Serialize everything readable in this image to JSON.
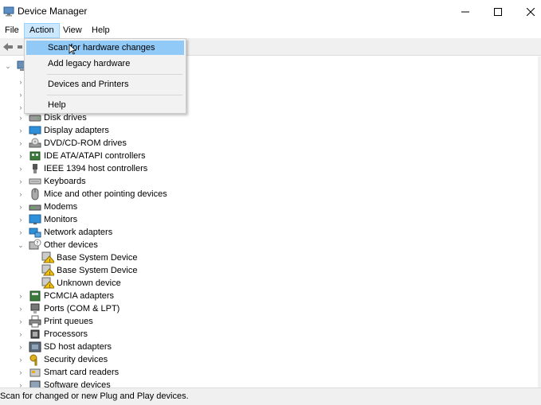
{
  "window": {
    "title": "Device Manager",
    "icons": {
      "app": "device-manager-icon",
      "minimize": "minimize-icon",
      "maximize": "maximize-icon",
      "close": "close-icon"
    }
  },
  "menubar": {
    "file": "File",
    "action": "Action",
    "view": "View",
    "help": "Help"
  },
  "action_menu": {
    "items": [
      {
        "label": "Scan for hardware changes",
        "highlighted": true
      },
      {
        "label": "Add legacy hardware"
      },
      {
        "label": "Devices and Printers"
      },
      {
        "label": "Help"
      }
    ]
  },
  "tree": {
    "items": [
      {
        "label": "Disk drives",
        "icon": "disk-drive-icon",
        "expanded": false
      },
      {
        "label": "Display adapters",
        "icon": "display-adapter-icon",
        "expanded": false
      },
      {
        "label": "DVD/CD-ROM drives",
        "icon": "dvd-drive-icon",
        "expanded": false
      },
      {
        "label": "IDE ATA/ATAPI controllers",
        "icon": "ide-controller-icon",
        "expanded": false
      },
      {
        "label": "IEEE 1394 host controllers",
        "icon": "firewire-icon",
        "expanded": false
      },
      {
        "label": "Keyboards",
        "icon": "keyboard-icon",
        "expanded": false
      },
      {
        "label": "Mice and other pointing devices",
        "icon": "mouse-icon",
        "expanded": false
      },
      {
        "label": "Modems",
        "icon": "modem-icon",
        "expanded": false
      },
      {
        "label": "Monitors",
        "icon": "monitor-icon",
        "expanded": false
      },
      {
        "label": "Network adapters",
        "icon": "network-adapter-icon",
        "expanded": false
      },
      {
        "label": "Other devices",
        "icon": "other-devices-icon",
        "expanded": true
      },
      {
        "label": "Base System Device",
        "icon": "warning-device-icon",
        "child": true
      },
      {
        "label": "Base System Device",
        "icon": "warning-device-icon",
        "child": true
      },
      {
        "label": "Unknown device",
        "icon": "warning-device-icon",
        "child": true
      },
      {
        "label": "PCMCIA adapters",
        "icon": "pcmcia-icon",
        "expanded": false
      },
      {
        "label": "Ports (COM & LPT)",
        "icon": "port-icon",
        "expanded": false
      },
      {
        "label": "Print queues",
        "icon": "printer-icon",
        "expanded": false
      },
      {
        "label": "Processors",
        "icon": "processor-icon",
        "expanded": false
      },
      {
        "label": "SD host adapters",
        "icon": "sd-card-icon",
        "expanded": false
      },
      {
        "label": "Security devices",
        "icon": "security-key-icon",
        "expanded": false
      },
      {
        "label": "Smart card readers",
        "icon": "smart-card-icon",
        "expanded": false
      },
      {
        "label": "Software devices",
        "icon": "software-device-icon",
        "expanded": false
      }
    ]
  },
  "statusbar": {
    "text": "Scan for changed or new Plug and Play devices."
  },
  "colors": {
    "menu_highlight": "#91c9f7",
    "menu_open": "#cce8ff",
    "warning": "#f4c20d"
  }
}
